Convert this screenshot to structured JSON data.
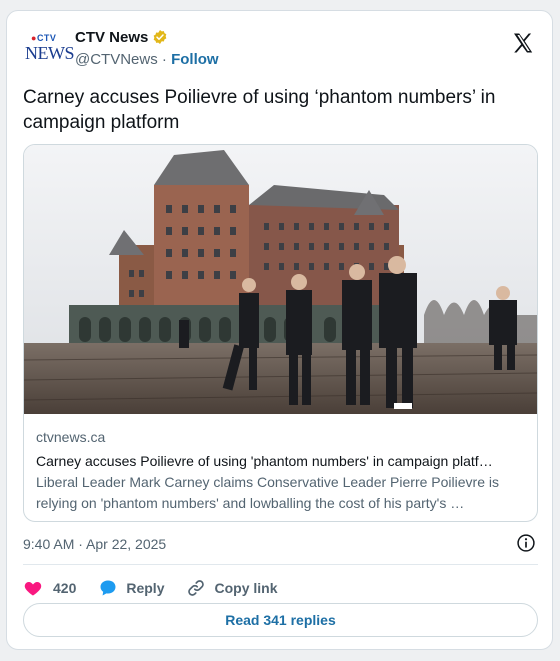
{
  "account": {
    "logo_top": "CTV",
    "logo_bottom": "NEWS",
    "name": "CTV News",
    "handle": "@CTVNews",
    "separator": "·",
    "follow_label": "Follow"
  },
  "tweet": {
    "text": "Carney accuses Poilievre of using ‘phantom numbers’ in campaign platform",
    "timestamp": "9:40 AM · Apr 22, 2025"
  },
  "link_card": {
    "domain": "ctvnews.ca",
    "title": "Carney accuses Poilievre of using 'phantom numbers' in campaign platf…",
    "description": "Liberal Leader Mark Carney claims Conservative Leader Pierre Poilievre is relying on 'phantom numbers' and lowballing the cost of his party's …",
    "image_icon": "photo-chateau-frontenac-group-walking"
  },
  "actions": {
    "like_count": "420",
    "reply_label": "Reply",
    "copy_label": "Copy link",
    "read_replies_label": "Read 341 replies"
  },
  "colors": {
    "accent": "#1d6fa5",
    "like": "#f91880",
    "reply": "#1d9bf0",
    "verified": "#e2b719"
  },
  "icons": [
    "verified-badge-icon",
    "x-logo-icon",
    "info-icon",
    "heart-icon",
    "reply-bubble-icon",
    "link-icon"
  ]
}
